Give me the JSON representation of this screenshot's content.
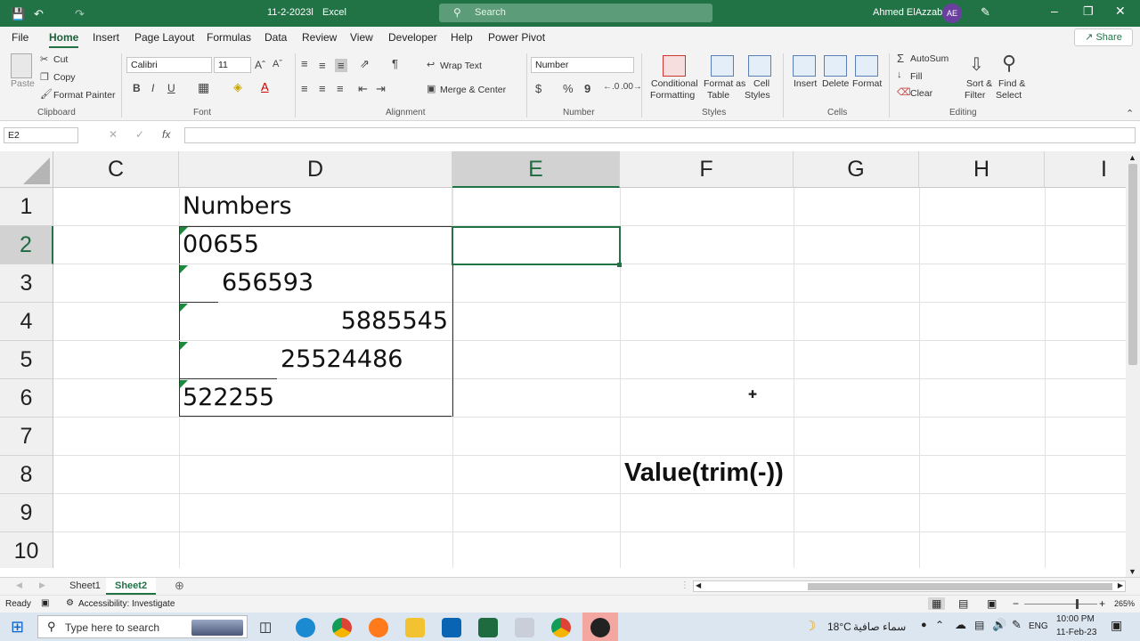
{
  "titlebar": {
    "filename": "11-2-2023l",
    "app": "Excel",
    "search_placeholder": "Search",
    "user": "Ahmed ElAzzab",
    "initials": "AE"
  },
  "menu": [
    "File",
    "Home",
    "Insert",
    "Page Layout",
    "Formulas",
    "Data",
    "Review",
    "View",
    "Developer",
    "Help",
    "Power Pivot"
  ],
  "share_label": "Share",
  "ribbon": {
    "clipboard": {
      "paste": "Paste",
      "cut": "Cut",
      "copy": "Copy",
      "format_painter": "Format Painter",
      "group": "Clipboard"
    },
    "font": {
      "name": "Calibri",
      "size": "11",
      "bold": "B",
      "italic": "I",
      "underline": "U",
      "group": "Font"
    },
    "alignment": {
      "wrap": "Wrap Text",
      "merge": "Merge & Center",
      "group": "Alignment"
    },
    "number": {
      "format": "Number",
      "currency": "$",
      "percent": "%",
      "comma": "9",
      "group": "Number"
    },
    "styles": {
      "cond1": "Conditional",
      "cond2": "Formatting",
      "table1": "Format as",
      "table2": "Table",
      "cell1": "Cell",
      "cell2": "Styles",
      "group": "Styles"
    },
    "cells": {
      "insert": "Insert",
      "delete": "Delete",
      "format": "Format",
      "group": "Cells"
    },
    "editing": {
      "autosum": "AutoSum",
      "fill": "Fill",
      "clear": "Clear",
      "sort1": "Sort &",
      "sort2": "Filter",
      "find1": "Find &",
      "find2": "Select",
      "group": "Editing"
    }
  },
  "formula_bar": {
    "name_box": "E2",
    "fx": "fx",
    "formula": ""
  },
  "columns": [
    "C",
    "D",
    "E",
    "F",
    "G",
    "H",
    "I"
  ],
  "rows": [
    "1",
    "2",
    "3",
    "4",
    "5",
    "6",
    "7",
    "8",
    "9",
    "10"
  ],
  "cells": {
    "D1": "Numbers",
    "D2": "00655",
    "D3": "656593",
    "D4": "5885545",
    "D5": "25524486",
    "D6": "522255",
    "F8": "Value(trim(-))"
  },
  "sheets": [
    "Sheet1",
    "Sheet2"
  ],
  "status": {
    "ready": "Ready",
    "accessibility": "Accessibility: Investigate",
    "zoom": "265%"
  },
  "taskbar": {
    "search_placeholder": "Type here to search",
    "temp": "18°C",
    "weather": "سماء صافية",
    "lang": "ENG",
    "time": "10:00 PM",
    "date": "11-Feb-23"
  },
  "colors": {
    "excel_green": "#217346",
    "selected_header": "#d2d2d2",
    "error_triangle": "#1b8a3c"
  }
}
